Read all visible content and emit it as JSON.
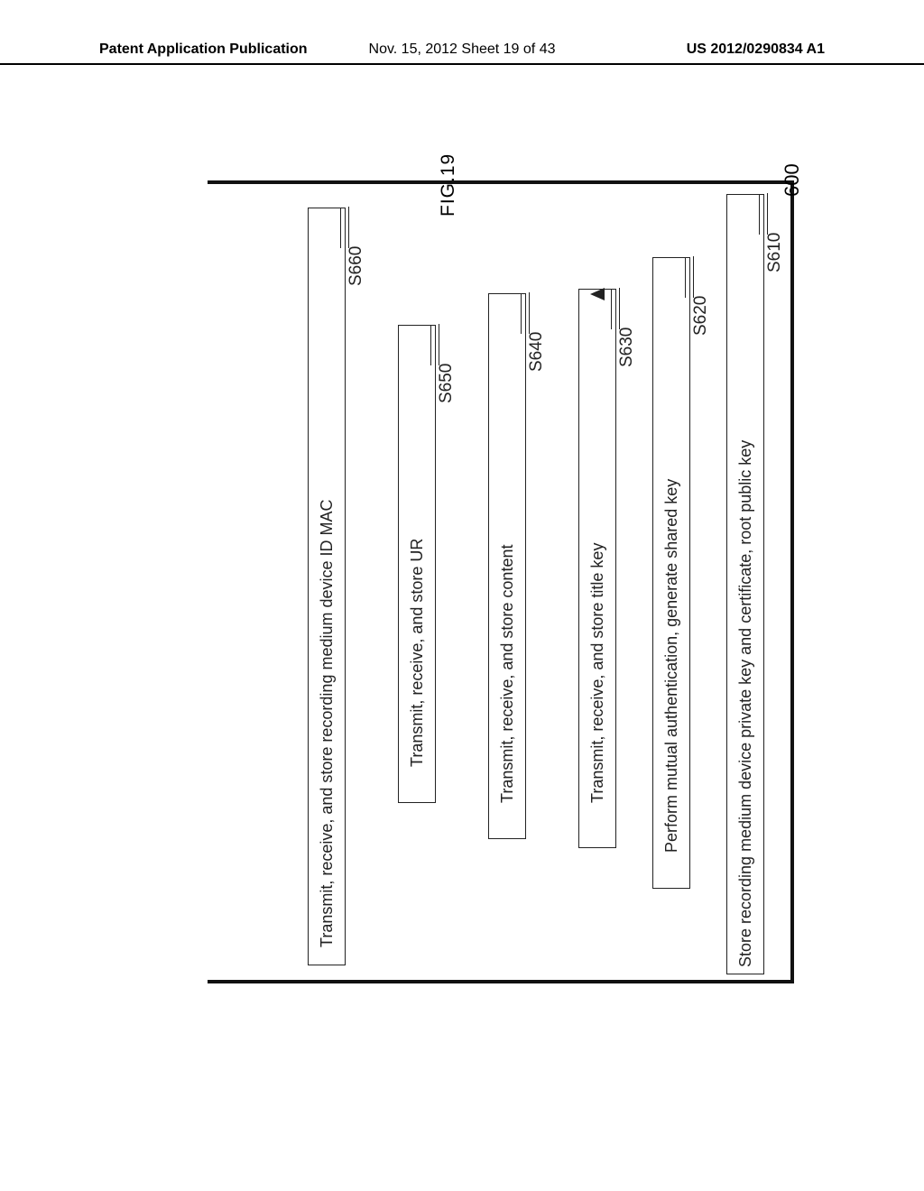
{
  "header": {
    "left": "Patent Application Publication",
    "center": "Nov. 15, 2012  Sheet 19 of 43",
    "right": "US 2012/0290834 A1"
  },
  "figure": {
    "title": "FIG.19",
    "outer_label": "600",
    "steps": [
      {
        "id": "S610",
        "text": "Store recording medium device private key and certificate, root public key"
      },
      {
        "id": "S620",
        "text": "Perform mutual authentication, generate shared key"
      },
      {
        "id": "S630",
        "text": "Transmit, receive, and store title key"
      },
      {
        "id": "S640",
        "text": "Transmit, receive, and store content"
      },
      {
        "id": "S650",
        "text": "Transmit, receive, and store UR"
      },
      {
        "id": "S660",
        "text": "Transmit, receive, and store recording medium device ID MAC"
      }
    ]
  }
}
